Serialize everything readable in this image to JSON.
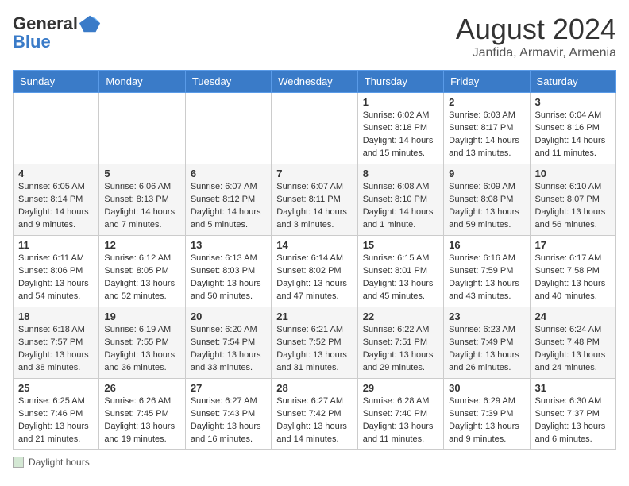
{
  "header": {
    "logo_line1": "General",
    "logo_line2": "Blue",
    "month_year": "August 2024",
    "location": "Janfida, Armavir, Armenia"
  },
  "days_of_week": [
    "Sunday",
    "Monday",
    "Tuesday",
    "Wednesday",
    "Thursday",
    "Friday",
    "Saturday"
  ],
  "weeks": [
    [
      {
        "day": "",
        "info": ""
      },
      {
        "day": "",
        "info": ""
      },
      {
        "day": "",
        "info": ""
      },
      {
        "day": "",
        "info": ""
      },
      {
        "day": "1",
        "info": "Sunrise: 6:02 AM\nSunset: 8:18 PM\nDaylight: 14 hours\nand 15 minutes."
      },
      {
        "day": "2",
        "info": "Sunrise: 6:03 AM\nSunset: 8:17 PM\nDaylight: 14 hours\nand 13 minutes."
      },
      {
        "day": "3",
        "info": "Sunrise: 6:04 AM\nSunset: 8:16 PM\nDaylight: 14 hours\nand 11 minutes."
      }
    ],
    [
      {
        "day": "4",
        "info": "Sunrise: 6:05 AM\nSunset: 8:14 PM\nDaylight: 14 hours\nand 9 minutes."
      },
      {
        "day": "5",
        "info": "Sunrise: 6:06 AM\nSunset: 8:13 PM\nDaylight: 14 hours\nand 7 minutes."
      },
      {
        "day": "6",
        "info": "Sunrise: 6:07 AM\nSunset: 8:12 PM\nDaylight: 14 hours\nand 5 minutes."
      },
      {
        "day": "7",
        "info": "Sunrise: 6:07 AM\nSunset: 8:11 PM\nDaylight: 14 hours\nand 3 minutes."
      },
      {
        "day": "8",
        "info": "Sunrise: 6:08 AM\nSunset: 8:10 PM\nDaylight: 14 hours\nand 1 minute."
      },
      {
        "day": "9",
        "info": "Sunrise: 6:09 AM\nSunset: 8:08 PM\nDaylight: 13 hours\nand 59 minutes."
      },
      {
        "day": "10",
        "info": "Sunrise: 6:10 AM\nSunset: 8:07 PM\nDaylight: 13 hours\nand 56 minutes."
      }
    ],
    [
      {
        "day": "11",
        "info": "Sunrise: 6:11 AM\nSunset: 8:06 PM\nDaylight: 13 hours\nand 54 minutes."
      },
      {
        "day": "12",
        "info": "Sunrise: 6:12 AM\nSunset: 8:05 PM\nDaylight: 13 hours\nand 52 minutes."
      },
      {
        "day": "13",
        "info": "Sunrise: 6:13 AM\nSunset: 8:03 PM\nDaylight: 13 hours\nand 50 minutes."
      },
      {
        "day": "14",
        "info": "Sunrise: 6:14 AM\nSunset: 8:02 PM\nDaylight: 13 hours\nand 47 minutes."
      },
      {
        "day": "15",
        "info": "Sunrise: 6:15 AM\nSunset: 8:01 PM\nDaylight: 13 hours\nand 45 minutes."
      },
      {
        "day": "16",
        "info": "Sunrise: 6:16 AM\nSunset: 7:59 PM\nDaylight: 13 hours\nand 43 minutes."
      },
      {
        "day": "17",
        "info": "Sunrise: 6:17 AM\nSunset: 7:58 PM\nDaylight: 13 hours\nand 40 minutes."
      }
    ],
    [
      {
        "day": "18",
        "info": "Sunrise: 6:18 AM\nSunset: 7:57 PM\nDaylight: 13 hours\nand 38 minutes."
      },
      {
        "day": "19",
        "info": "Sunrise: 6:19 AM\nSunset: 7:55 PM\nDaylight: 13 hours\nand 36 minutes."
      },
      {
        "day": "20",
        "info": "Sunrise: 6:20 AM\nSunset: 7:54 PM\nDaylight: 13 hours\nand 33 minutes."
      },
      {
        "day": "21",
        "info": "Sunrise: 6:21 AM\nSunset: 7:52 PM\nDaylight: 13 hours\nand 31 minutes."
      },
      {
        "day": "22",
        "info": "Sunrise: 6:22 AM\nSunset: 7:51 PM\nDaylight: 13 hours\nand 29 minutes."
      },
      {
        "day": "23",
        "info": "Sunrise: 6:23 AM\nSunset: 7:49 PM\nDaylight: 13 hours\nand 26 minutes."
      },
      {
        "day": "24",
        "info": "Sunrise: 6:24 AM\nSunset: 7:48 PM\nDaylight: 13 hours\nand 24 minutes."
      }
    ],
    [
      {
        "day": "25",
        "info": "Sunrise: 6:25 AM\nSunset: 7:46 PM\nDaylight: 13 hours\nand 21 minutes."
      },
      {
        "day": "26",
        "info": "Sunrise: 6:26 AM\nSunset: 7:45 PM\nDaylight: 13 hours\nand 19 minutes."
      },
      {
        "day": "27",
        "info": "Sunrise: 6:27 AM\nSunset: 7:43 PM\nDaylight: 13 hours\nand 16 minutes."
      },
      {
        "day": "28",
        "info": "Sunrise: 6:27 AM\nSunset: 7:42 PM\nDaylight: 13 hours\nand 14 minutes."
      },
      {
        "day": "29",
        "info": "Sunrise: 6:28 AM\nSunset: 7:40 PM\nDaylight: 13 hours\nand 11 minutes."
      },
      {
        "day": "30",
        "info": "Sunrise: 6:29 AM\nSunset: 7:39 PM\nDaylight: 13 hours\nand 9 minutes."
      },
      {
        "day": "31",
        "info": "Sunrise: 6:30 AM\nSunset: 7:37 PM\nDaylight: 13 hours\nand 6 minutes."
      }
    ]
  ],
  "footer": {
    "legend_label": "Daylight hours"
  }
}
